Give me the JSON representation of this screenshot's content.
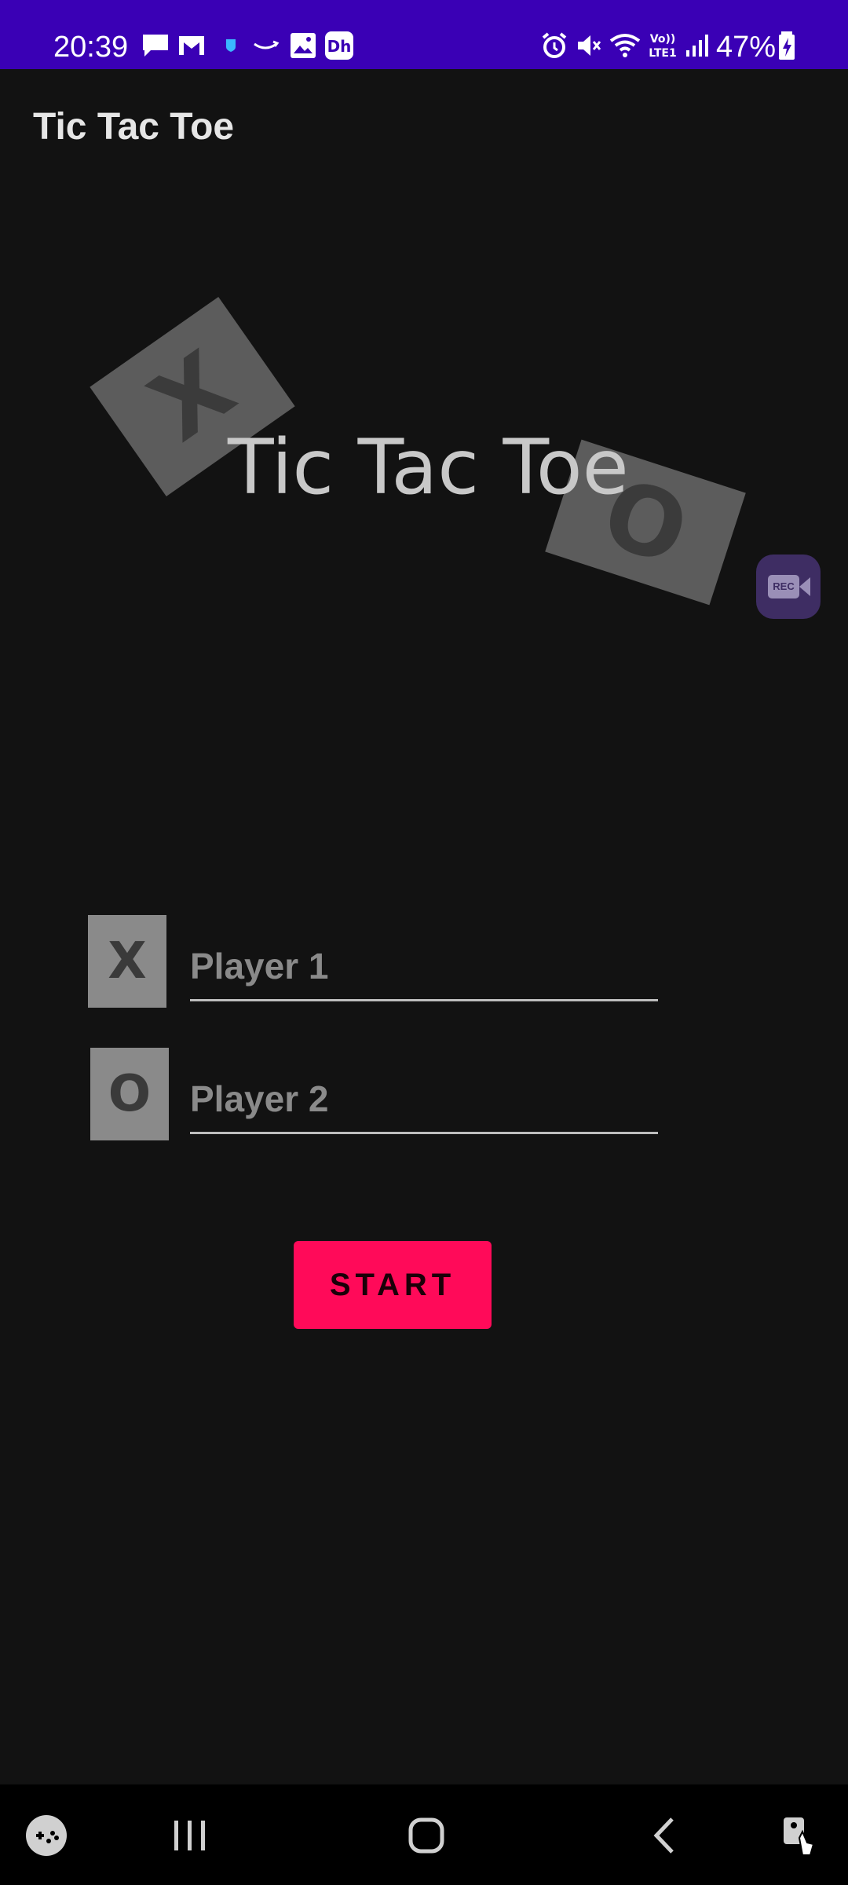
{
  "status_bar": {
    "time": "20:39",
    "battery": "47%",
    "icons": [
      "message-icon",
      "gmail-icon",
      "shield-icon",
      "amazon-icon",
      "gallery-icon",
      "hotstar-icon",
      "alarm-icon",
      "mute-icon",
      "wifi-icon",
      "volte-icon",
      "signal-icon",
      "battery-charging-icon"
    ],
    "background": "#3a00b5"
  },
  "app_bar": {
    "title": "Tic Tac Toe"
  },
  "logo": {
    "title": "Tic Tac Toe",
    "tile_x": "X",
    "tile_o": "O"
  },
  "rec_button": {
    "label": "REC",
    "icon": "video-record-icon"
  },
  "players": {
    "player1": {
      "symbol": "X",
      "placeholder": "Player 1",
      "value": ""
    },
    "player2": {
      "symbol": "O",
      "placeholder": "Player 2",
      "value": ""
    }
  },
  "start_button": {
    "label": "START",
    "color": "#ff0a59"
  },
  "nav_bar": {
    "buttons": [
      "game-launcher-icon",
      "recents-icon",
      "home-icon",
      "back-icon",
      "accessibility-icon"
    ]
  }
}
